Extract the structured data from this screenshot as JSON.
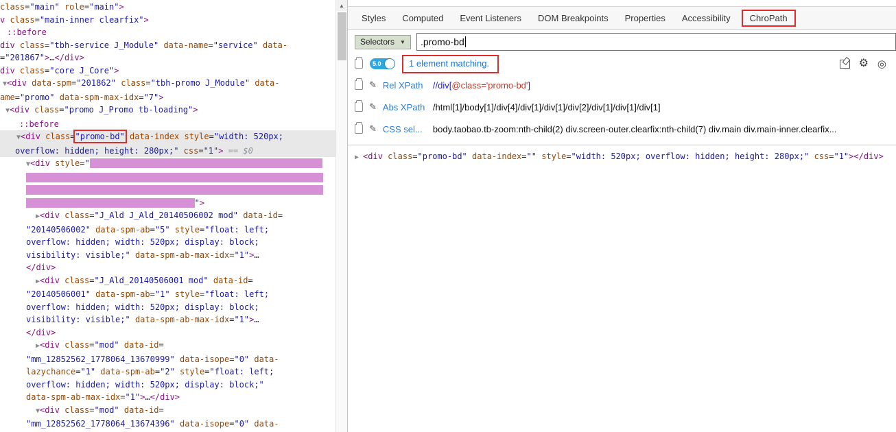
{
  "icons": {
    "chevron_down": "▼",
    "scroll_up": "▲",
    "pencil": "✎",
    "gear": "⚙",
    "circle": "◎"
  },
  "left_panel": {
    "lines": [
      {
        "ind": 0,
        "sel": false,
        "seg": [
          [
            "a",
            "class"
          ],
          [
            "p",
            "="
          ],
          [
            "v",
            "\"main\""
          ],
          [
            "p",
            " "
          ],
          [
            "a",
            "role"
          ],
          [
            "p",
            "="
          ],
          [
            "v",
            "\"main\""
          ],
          [
            "t",
            ">"
          ]
        ]
      },
      {
        "ind": 0,
        "sel": false,
        "seg": [
          [
            "t",
            "v "
          ],
          [
            "a",
            "class"
          ],
          [
            "p",
            "="
          ],
          [
            "v",
            "\"main-inner clearfix\""
          ],
          [
            "t",
            ">"
          ]
        ]
      },
      {
        "ind": 10,
        "sel": false,
        "seg": [
          [
            "t",
            "::before"
          ]
        ]
      },
      {
        "ind": 0,
        "sel": false,
        "seg": [
          [
            "t",
            "div "
          ],
          [
            "a",
            "class"
          ],
          [
            "p",
            "="
          ],
          [
            "v",
            "\"tbh-service J_Module\""
          ],
          [
            "p",
            " "
          ],
          [
            "a",
            "data-name"
          ],
          [
            "p",
            "="
          ],
          [
            "v",
            "\"service\""
          ],
          [
            "p",
            " "
          ],
          [
            "a",
            "data-"
          ]
        ]
      },
      {
        "ind": 0,
        "sel": false,
        "seg": [
          [
            "p",
            "="
          ],
          [
            "v",
            "\"201867\""
          ],
          [
            "t",
            ">"
          ],
          [
            "p",
            "…"
          ],
          [
            "t",
            "</div>"
          ]
        ]
      },
      {
        "ind": 0,
        "sel": false,
        "seg": [
          [
            "t",
            "div "
          ],
          [
            "a",
            "class"
          ],
          [
            "p",
            "="
          ],
          [
            "v",
            "\"core J_Core\""
          ],
          [
            "t",
            ">"
          ]
        ]
      },
      {
        "ind": 4,
        "sel": false,
        "seg": [
          [
            "g",
            "▼"
          ],
          [
            "t",
            "<div "
          ],
          [
            "a",
            "data-spm"
          ],
          [
            "p",
            "="
          ],
          [
            "v",
            "\"201862\""
          ],
          [
            "p",
            " "
          ],
          [
            "a",
            "class"
          ],
          [
            "p",
            "="
          ],
          [
            "v",
            "\"tbh-promo J_Module\""
          ],
          [
            "p",
            " "
          ],
          [
            "a",
            "data-"
          ]
        ]
      },
      {
        "ind": 0,
        "sel": false,
        "seg": [
          [
            "a",
            "ame"
          ],
          [
            "p",
            "="
          ],
          [
            "v",
            "\"promo\""
          ],
          [
            "p",
            " "
          ],
          [
            "a",
            "data-spm-max-idx"
          ],
          [
            "p",
            "="
          ],
          [
            "v",
            "\"7\""
          ],
          [
            "t",
            ">"
          ]
        ]
      },
      {
        "ind": 8,
        "sel": false,
        "seg": [
          [
            "g",
            "▼"
          ],
          [
            "t",
            "<div "
          ],
          [
            "a",
            "class"
          ],
          [
            "p",
            "="
          ],
          [
            "v",
            "\"promo J_Promo tb-loading\""
          ],
          [
            "t",
            ">"
          ]
        ]
      },
      {
        "ind": 28,
        "sel": false,
        "seg": [
          [
            "t",
            "::before"
          ]
        ]
      },
      {
        "ind": 24,
        "sel": true,
        "seg": [
          [
            "g",
            "▼"
          ],
          [
            "t",
            "<div "
          ],
          [
            "a",
            "class"
          ],
          [
            "p",
            "="
          ],
          [
            "rb",
            "\"promo-bd\""
          ],
          [
            "p",
            " "
          ],
          [
            "a",
            "data-index"
          ],
          [
            "p",
            " "
          ],
          [
            "a",
            "style"
          ],
          [
            "p",
            "="
          ],
          [
            "v",
            "\"width: 520px;"
          ]
        ]
      },
      {
        "ind": 22,
        "sel": true,
        "seg": [
          [
            "v",
            "overflow: hidden; height: 280px;\""
          ],
          [
            "p",
            " "
          ],
          [
            "a",
            "css"
          ],
          [
            "p",
            "="
          ],
          [
            "v",
            "\"1\""
          ],
          [
            "t",
            ">"
          ],
          [
            "d",
            " == $0"
          ]
        ]
      },
      {
        "ind": 38,
        "sel": false,
        "seg": [
          [
            "g",
            "▼"
          ],
          [
            "t",
            "<div "
          ],
          [
            "a",
            "style"
          ],
          [
            "p",
            "="
          ],
          [
            "v",
            "\""
          ],
          [
            "pk",
            "                                               "
          ]
        ]
      },
      {
        "ind": 38,
        "sel": false,
        "seg": [
          [
            "pk",
            "                                                            "
          ]
        ]
      },
      {
        "ind": 38,
        "sel": false,
        "seg": [
          [
            "pk",
            "                                                            "
          ]
        ]
      },
      {
        "ind": 38,
        "sel": false,
        "seg": [
          [
            "pk",
            "                                  "
          ],
          [
            "v",
            "\""
          ],
          [
            "t",
            ">"
          ]
        ]
      },
      {
        "ind": 52,
        "sel": false,
        "seg": [
          [
            "g",
            "▶"
          ],
          [
            "t",
            "<div "
          ],
          [
            "a",
            "class"
          ],
          [
            "p",
            "="
          ],
          [
            "v",
            "\"J_Ald J_Ald_20140506002 mod\""
          ],
          [
            "p",
            " "
          ],
          [
            "a",
            "data-id"
          ],
          [
            "p",
            "="
          ]
        ]
      },
      {
        "ind": 38,
        "sel": false,
        "seg": [
          [
            "v",
            "\"20140506002\""
          ],
          [
            "p",
            " "
          ],
          [
            "a",
            "data-spm-ab"
          ],
          [
            "p",
            "="
          ],
          [
            "v",
            "\"5\""
          ],
          [
            "p",
            " "
          ],
          [
            "a",
            "style"
          ],
          [
            "p",
            "="
          ],
          [
            "v",
            "\"float: left;"
          ]
        ]
      },
      {
        "ind": 38,
        "sel": false,
        "seg": [
          [
            "v",
            "overflow: hidden; width: 520px; display: block;"
          ]
        ]
      },
      {
        "ind": 38,
        "sel": false,
        "seg": [
          [
            "v",
            "visibility: visible;\""
          ],
          [
            "p",
            " "
          ],
          [
            "a",
            "data-spm-ab-max-idx"
          ],
          [
            "p",
            "="
          ],
          [
            "v",
            "\"1\""
          ],
          [
            "t",
            ">"
          ],
          [
            "p",
            "…"
          ]
        ]
      },
      {
        "ind": 38,
        "sel": false,
        "seg": [
          [
            "t",
            "</div>"
          ]
        ]
      },
      {
        "ind": 52,
        "sel": false,
        "seg": [
          [
            "g",
            "▶"
          ],
          [
            "t",
            "<div "
          ],
          [
            "a",
            "class"
          ],
          [
            "p",
            "="
          ],
          [
            "v",
            "\"J_Ald_20140506001 mod\""
          ],
          [
            "p",
            " "
          ],
          [
            "a",
            "data-id"
          ],
          [
            "p",
            "="
          ]
        ]
      },
      {
        "ind": 38,
        "sel": false,
        "seg": [
          [
            "v",
            "\"20140506001\""
          ],
          [
            "p",
            " "
          ],
          [
            "a",
            "data-spm-ab"
          ],
          [
            "p",
            "="
          ],
          [
            "v",
            "\"1\""
          ],
          [
            "p",
            " "
          ],
          [
            "a",
            "style"
          ],
          [
            "p",
            "="
          ],
          [
            "v",
            "\"float: left;"
          ]
        ]
      },
      {
        "ind": 38,
        "sel": false,
        "seg": [
          [
            "v",
            "overflow: hidden; width: 520px; display: block;"
          ]
        ]
      },
      {
        "ind": 38,
        "sel": false,
        "seg": [
          [
            "v",
            "visibility: visible;\""
          ],
          [
            "p",
            " "
          ],
          [
            "a",
            "data-spm-ab-max-idx"
          ],
          [
            "p",
            "="
          ],
          [
            "v",
            "\"1\""
          ],
          [
            "t",
            ">"
          ],
          [
            "p",
            "…"
          ]
        ]
      },
      {
        "ind": 38,
        "sel": false,
        "seg": [
          [
            "t",
            "</div>"
          ]
        ]
      },
      {
        "ind": 52,
        "sel": false,
        "seg": [
          [
            "g",
            "▶"
          ],
          [
            "t",
            "<div "
          ],
          [
            "a",
            "class"
          ],
          [
            "p",
            "="
          ],
          [
            "v",
            "\"mod\""
          ],
          [
            "p",
            " "
          ],
          [
            "a",
            "data-id"
          ],
          [
            "p",
            "="
          ]
        ]
      },
      {
        "ind": 38,
        "sel": false,
        "seg": [
          [
            "v",
            "\"mm_12852562_1778064_13670999\""
          ],
          [
            "p",
            " "
          ],
          [
            "a",
            "data-isope"
          ],
          [
            "p",
            "="
          ],
          [
            "v",
            "\"0\""
          ],
          [
            "p",
            " "
          ],
          [
            "a",
            "data-"
          ]
        ]
      },
      {
        "ind": 38,
        "sel": false,
        "seg": [
          [
            "a",
            "lazychance"
          ],
          [
            "p",
            "="
          ],
          [
            "v",
            "\"1\""
          ],
          [
            "p",
            " "
          ],
          [
            "a",
            "data-spm-ab"
          ],
          [
            "p",
            "="
          ],
          [
            "v",
            "\"2\""
          ],
          [
            "p",
            " "
          ],
          [
            "a",
            "style"
          ],
          [
            "p",
            "="
          ],
          [
            "v",
            "\"float: left;"
          ]
        ]
      },
      {
        "ind": 38,
        "sel": false,
        "seg": [
          [
            "v",
            "overflow: hidden; width: 520px; display: block;\""
          ]
        ]
      },
      {
        "ind": 38,
        "sel": false,
        "seg": [
          [
            "a",
            "data-spm-ab-max-idx"
          ],
          [
            "p",
            "="
          ],
          [
            "v",
            "\"1\""
          ],
          [
            "t",
            ">"
          ],
          [
            "p",
            "…"
          ],
          [
            "t",
            "</div>"
          ]
        ]
      },
      {
        "ind": 52,
        "sel": false,
        "seg": [
          [
            "g",
            "▼"
          ],
          [
            "t",
            "<div "
          ],
          [
            "a",
            "class"
          ],
          [
            "p",
            "="
          ],
          [
            "v",
            "\"mod\""
          ],
          [
            "p",
            " "
          ],
          [
            "a",
            "data-id"
          ],
          [
            "p",
            "="
          ]
        ]
      },
      {
        "ind": 38,
        "sel": false,
        "seg": [
          [
            "v",
            "\"mm_12852562_1778064_13674396\""
          ],
          [
            "p",
            " "
          ],
          [
            "a",
            "data-isope"
          ],
          [
            "p",
            "="
          ],
          [
            "v",
            "\"0\""
          ],
          [
            "p",
            " "
          ],
          [
            "a",
            "data-"
          ]
        ]
      }
    ]
  },
  "right_panel": {
    "tabs": [
      {
        "label": "Styles",
        "annotated": false
      },
      {
        "label": "Computed",
        "annotated": false
      },
      {
        "label": "Event Listeners",
        "annotated": false
      },
      {
        "label": "DOM Breakpoints",
        "annotated": false
      },
      {
        "label": "Properties",
        "annotated": false
      },
      {
        "label": "Accessibility",
        "annotated": false
      },
      {
        "label": "ChroPath",
        "annotated": true
      }
    ],
    "chropath": {
      "selectors_label": "Selectors",
      "query": ".promo-bd",
      "version": "5.0",
      "match_text": "1 element matching.",
      "rows": [
        {
          "label": "Rel XPath",
          "segments": [
            [
              "xb",
              "//div["
            ],
            [
              "xr",
              "@class='promo-bd'"
            ],
            [
              "xb",
              "]"
            ]
          ]
        },
        {
          "label": "Abs XPath",
          "segments": [
            [
              "xd",
              "/html[1]/body[1]/div[4]/div[1]/div[1]/div[2]/div[1]/div[1]/div[1]"
            ]
          ]
        },
        {
          "label": "CSS sel...",
          "segments": [
            [
              "xd",
              "body.taobao.tb-zoom:nth-child(2) div.screen-outer.clearfix:nth-child(7) div.main div.main-inner.clearfix..."
            ]
          ]
        }
      ],
      "result_seg": [
        [
          "g",
          "▶ "
        ],
        [
          "t",
          "<div "
        ],
        [
          "a",
          "class"
        ],
        [
          "p",
          "="
        ],
        [
          "v",
          "\"promo-bd\""
        ],
        [
          "p",
          " "
        ],
        [
          "a",
          "data-index"
        ],
        [
          "p",
          "="
        ],
        [
          "v",
          "\"\""
        ],
        [
          "p",
          " "
        ],
        [
          "a",
          "style"
        ],
        [
          "p",
          "="
        ],
        [
          "v",
          "\"width: 520px; overflow: hidden; height: 280px;\""
        ],
        [
          "p",
          " "
        ],
        [
          "a",
          "css"
        ],
        [
          "p",
          "="
        ],
        [
          "v",
          "\"1\""
        ],
        [
          "t",
          ">"
        ],
        [
          "t",
          "</div>"
        ]
      ]
    }
  }
}
